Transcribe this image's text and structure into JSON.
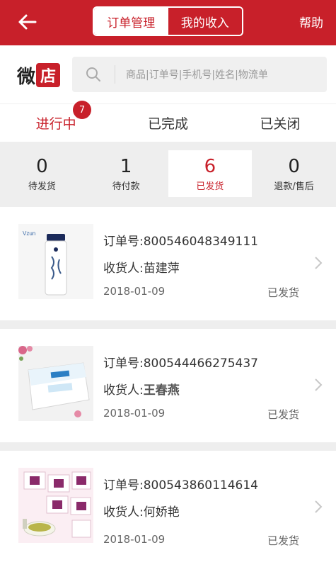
{
  "header": {
    "back_icon": "arrow-left-icon",
    "segments": [
      {
        "label": "订单管理",
        "active": true
      },
      {
        "label": "我的收入",
        "active": false
      }
    ],
    "help_label": "帮助",
    "brand_color": "#c8202a"
  },
  "logo": {
    "part1": "微",
    "part2": "店"
  },
  "search": {
    "icon": "search-icon",
    "placeholder": "商品|订单号|手机号|姓名|物流单"
  },
  "tabs": [
    {
      "label": "进行中",
      "badge": "7",
      "active": true
    },
    {
      "label": "已完成",
      "active": false
    },
    {
      "label": "已关闭",
      "active": false
    }
  ],
  "stats": [
    {
      "value": "0",
      "label": "待发货",
      "active": false
    },
    {
      "value": "1",
      "label": "待付款",
      "active": false
    },
    {
      "value": "6",
      "label": "已发货",
      "active": true
    },
    {
      "value": "0",
      "label": "退款/售后",
      "active": false
    }
  ],
  "orders": [
    {
      "order_label": "订单号:",
      "order_no": "800546048349111",
      "receiver_label": "收货人:",
      "receiver": "苗建萍",
      "date": "2018-01-09",
      "status": "已发货"
    },
    {
      "order_label": "订单号:",
      "order_no": "800544466275437",
      "receiver_label": "收货人:",
      "receiver": "王春燕",
      "date": "2018-01-09",
      "status": "已发货"
    },
    {
      "order_label": "订单号:",
      "order_no": "800543860114614",
      "receiver_label": "收货人:",
      "receiver": "何娇艳",
      "date": "2018-01-09",
      "status": "已发货"
    }
  ]
}
